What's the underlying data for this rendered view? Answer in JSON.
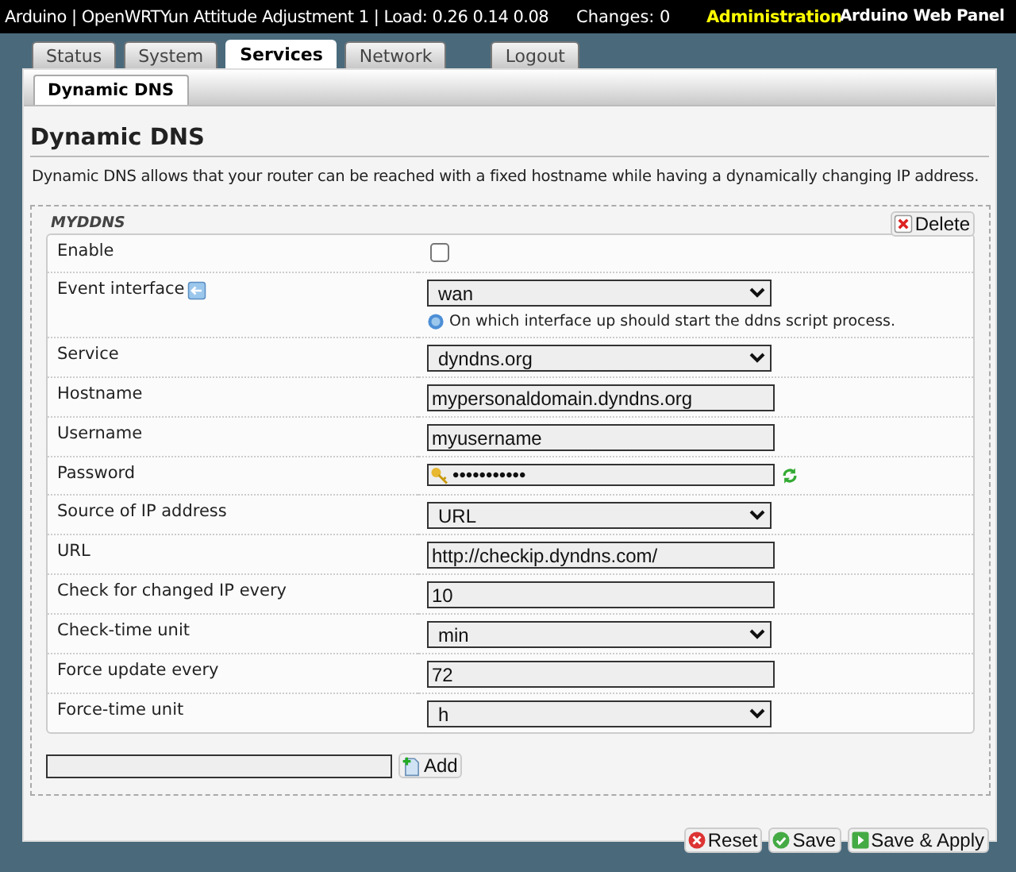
{
  "header": {
    "title": "Arduino | OpenWRTYun Attitude Adjustment 1 | Load: 0.26 0.14 0.08",
    "changes": "Changes: 0",
    "mode": "Administration",
    "panel_link": "Arduino Web Panel"
  },
  "tabs": [
    {
      "label": "Status",
      "selected": false,
      "kind": "page"
    },
    {
      "label": "System",
      "selected": false,
      "kind": "page"
    },
    {
      "label": "Services",
      "selected": true,
      "kind": "page"
    },
    {
      "label": "Network",
      "selected": false,
      "kind": "page"
    },
    {
      "label": "Logout",
      "selected": false,
      "kind": "logout"
    }
  ],
  "subtabs": [
    {
      "label": "Dynamic DNS",
      "selected": true
    }
  ],
  "page": {
    "heading": "Dynamic DNS",
    "description": "Dynamic DNS allows that your router can be reached with a fixed hostname while having a dynamically changing IP address."
  },
  "section": {
    "title": "MYDDNS",
    "delete_label": "Delete",
    "fields": [
      {
        "kind": "checkbox",
        "label": "Enable",
        "checked": false
      },
      {
        "kind": "select",
        "label": "Event interface",
        "value": "wan",
        "help": "On which interface up should start the ddns script process."
      },
      {
        "kind": "select",
        "label": "Service",
        "value": "dyndns.org"
      },
      {
        "kind": "text",
        "label": "Hostname",
        "value": "mypersonaldomain.dyndns.org"
      },
      {
        "kind": "text",
        "label": "Username",
        "value": "myusername"
      },
      {
        "kind": "password",
        "label": "Password",
        "value": "•••••••••••"
      },
      {
        "kind": "select",
        "label": "Source of IP address",
        "value": "URL"
      },
      {
        "kind": "text",
        "label": "URL",
        "value": "http://checkip.dyndns.com/"
      },
      {
        "kind": "text",
        "label": "Check for changed IP every",
        "value": "10"
      },
      {
        "kind": "select",
        "label": "Check-time unit",
        "value": "min"
      },
      {
        "kind": "text",
        "label": "Force update every",
        "value": "72"
      },
      {
        "kind": "select",
        "label": "Force-time unit",
        "value": "h"
      }
    ]
  },
  "add": {
    "button": "Add"
  },
  "actions": [
    {
      "kind": "reset",
      "label": "Reset"
    },
    {
      "kind": "save",
      "label": "Save"
    },
    {
      "kind": "apply",
      "label": "Save & Apply"
    }
  ]
}
